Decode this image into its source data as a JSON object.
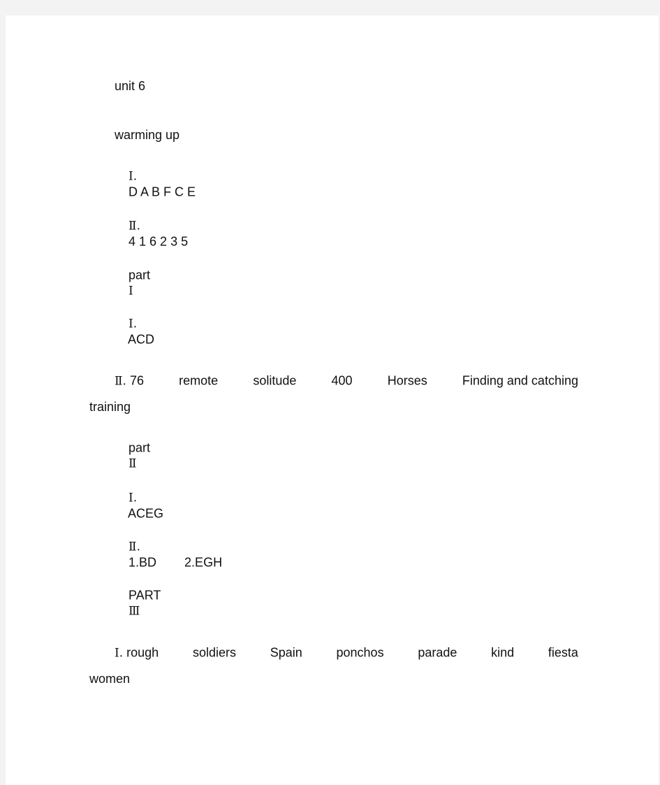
{
  "document": {
    "unit_title": "unit 6",
    "warming_up": {
      "heading": "warming up",
      "q1": {
        "label": "Ⅰ.",
        "answer": "D A B F C E"
      },
      "q2": {
        "label": "Ⅱ.",
        "answer": "4 1 6 2 3 5"
      }
    },
    "part1": {
      "heading_word": "part",
      "heading_numeral": "Ⅰ",
      "q1": {
        "label": "Ⅰ.",
        "answer": "ACD"
      },
      "q2": {
        "label": "Ⅱ.",
        "answers": [
          "76",
          "remote",
          "solitude",
          "400",
          "Horses",
          "Finding and catching"
        ],
        "continuation": "training"
      }
    },
    "part2": {
      "heading_word": "part",
      "heading_numeral": "Ⅱ",
      "q1": {
        "label": "Ⅰ.",
        "answer": "ACEG"
      },
      "q2": {
        "label": "Ⅱ.",
        "answer_1": "1.BD",
        "answer_2": "2.EGH"
      }
    },
    "part3": {
      "heading_word": "PART",
      "heading_numeral": "Ⅲ",
      "q1": {
        "label": "Ⅰ.",
        "answers": [
          "rough",
          "soldiers",
          "Spain",
          "ponchos",
          "parade",
          "kind",
          "fiesta"
        ],
        "continuation": "women"
      }
    }
  }
}
